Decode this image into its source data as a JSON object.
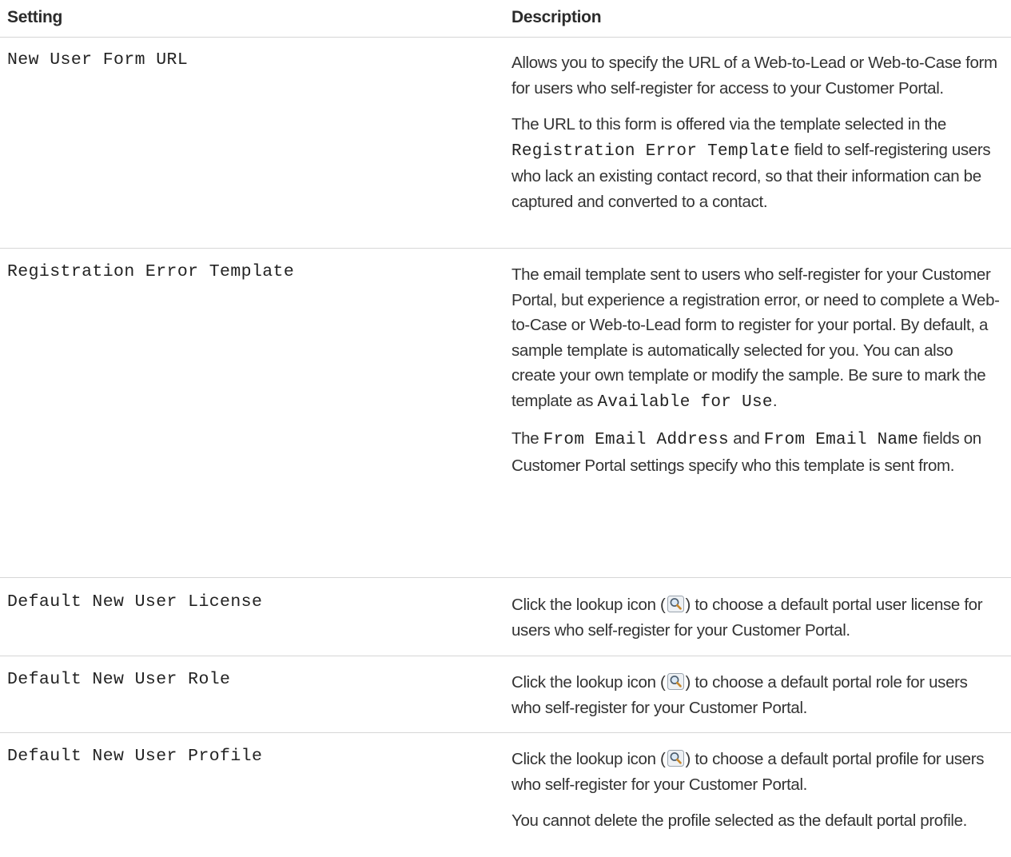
{
  "table": {
    "headers": {
      "setting": "Setting",
      "description": "Description"
    },
    "rows": [
      {
        "setting": "New User Form URL",
        "p1": "Allows you to specify the URL of a Web-to-Lead or Web-to-Case form for users who self-register for access to your Customer Portal.",
        "p2_a": "The URL to this form is offered via the template selected in the ",
        "p2_code": "Registration Error Template",
        "p2_b": " field to self-registering users who lack an existing contact record, so that their information can be captured and converted to a contact."
      },
      {
        "setting": "Registration Error Template",
        "p1_a": "The email template sent to users who self-register for your Customer Portal, but experience a registration error, or need to complete a Web-to-Case or Web-to-Lead form to register for your portal. By default, a sample template is automatically selected for you. You can also create your own template or modify the sample. Be sure to mark the template as ",
        "p1_code": "Available for Use",
        "p1_b": ".",
        "p2_a": "The ",
        "p2_code1": "From Email Address",
        "p2_b": " and ",
        "p2_code2": "From Email Name",
        "p2_c": " fields on Customer Portal settings specify who this template is sent from."
      },
      {
        "setting": "Default New User License",
        "p1_a": "Click the lookup icon (",
        "p1_b": ") to choose a default portal user license for users who self-register for your Customer Portal."
      },
      {
        "setting": "Default New User Role",
        "p1_a": "Click the lookup icon (",
        "p1_b": ") to choose a default portal role for users who self-register for your Customer Portal."
      },
      {
        "setting": "Default New User Profile",
        "p1_a": "Click the lookup icon (",
        "p1_b": ") to choose a default portal profile for users who self-register for your Customer Portal.",
        "p2": "You cannot delete the profile selected as the default portal profile."
      }
    ]
  },
  "icons": {
    "lookup": "lookup-icon"
  },
  "colors": {
    "text": "#333333",
    "divider": "#d6d6d6"
  }
}
